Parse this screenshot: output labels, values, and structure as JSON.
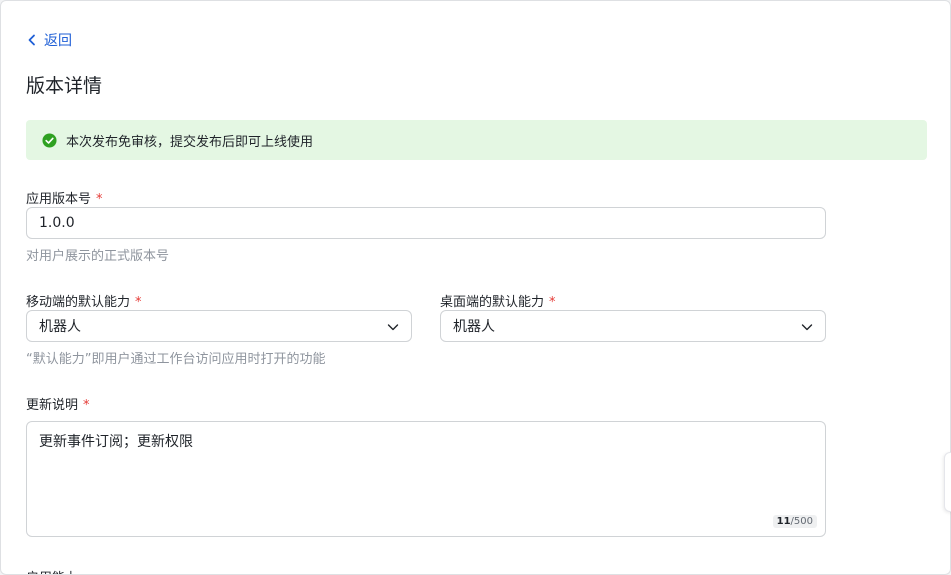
{
  "nav": {
    "back_label": "返回"
  },
  "page": {
    "title": "版本详情"
  },
  "alert": {
    "text": "本次发布免审核，提交发布后即可上线使用",
    "color": "#e4f7e3",
    "icon": "check-circle-icon"
  },
  "version": {
    "label": "应用版本号",
    "required_mark": "*",
    "value": "1.0.0",
    "help": "对用户展示的正式版本号"
  },
  "mobile_default": {
    "label": "移动端的默认能力",
    "required_mark": "*",
    "selected": "机器人"
  },
  "desktop_default": {
    "label": "桌面端的默认能力",
    "required_mark": "*",
    "selected": "机器人"
  },
  "default_help": "“默认能力”即用户通过工作台访问应用时打开的功能",
  "release_notes": {
    "label": "更新说明",
    "required_mark": "*",
    "value": "更新事件订阅；更新权限",
    "count_current": "11",
    "count_max": "/500"
  },
  "next_section_label": "启用能力",
  "colors": {
    "accent": "#1f5fd6",
    "required": "#e53935",
    "success": "#2ea121"
  }
}
